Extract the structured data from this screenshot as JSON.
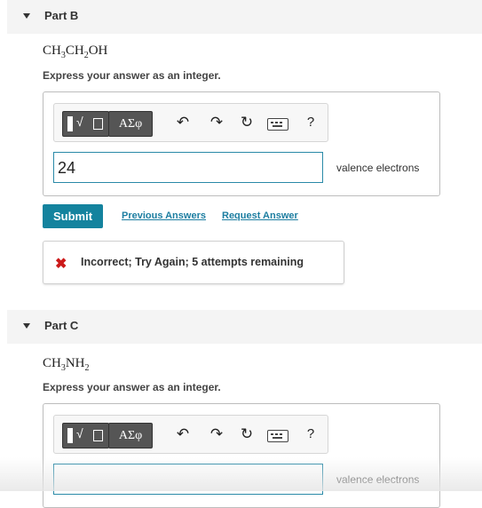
{
  "partB": {
    "title": "Part B",
    "formula": {
      "p1": "CH",
      "s1": "3",
      "p2": "CH",
      "s2": "2",
      "p3": "OH"
    },
    "instruction": "Express your answer as an integer.",
    "toolbar": {
      "greek_label": "ΑΣφ",
      "help_label": "?"
    },
    "answer_value": "24",
    "unit": "valence electrons",
    "submit_label": "Submit",
    "previous_answers_label": "Previous Answers",
    "request_answer_label": "Request Answer",
    "feedback": "Incorrect; Try Again; 5 attempts remaining"
  },
  "partC": {
    "title": "Part C",
    "formula": {
      "p1": "CH",
      "s1": "3",
      "p2": "NH",
      "s2": "2"
    },
    "instruction": "Express your answer as an integer.",
    "toolbar": {
      "greek_label": "ΑΣφ",
      "help_label": "?"
    },
    "answer_value": "",
    "unit": "valence electrons"
  },
  "icons": {
    "undo": "undo-icon",
    "redo": "redo-icon",
    "reset": "reset-icon",
    "keyboard": "keyboard-icon",
    "templates": "math-templates-icon",
    "incorrect": "incorrect-x-icon"
  },
  "colors": {
    "accent": "#14839e",
    "link": "#1d7ea1",
    "error": "#cc1a1a",
    "header_bg": "#f4f4f4"
  }
}
